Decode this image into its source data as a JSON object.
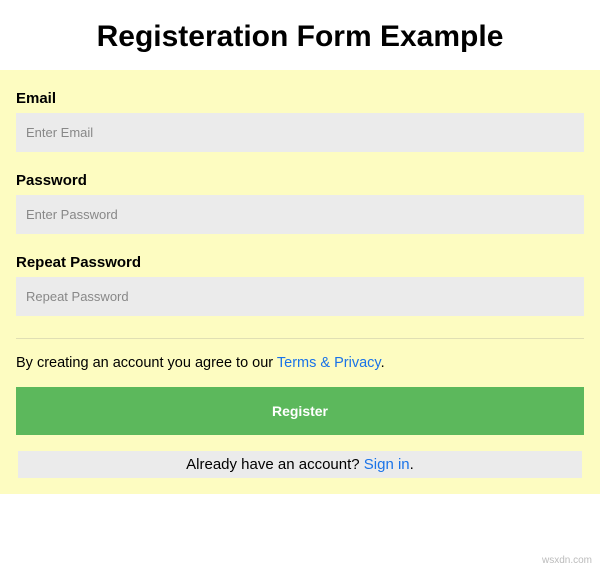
{
  "title": "Registeration Form Example",
  "form": {
    "email": {
      "label": "Email",
      "placeholder": "Enter Email",
      "value": ""
    },
    "password": {
      "label": "Password",
      "placeholder": "Enter Password",
      "value": ""
    },
    "repeat_password": {
      "label": "Repeat Password",
      "placeholder": "Repeat Password",
      "value": ""
    },
    "agree_prefix": "By creating an account you agree to our ",
    "agree_link": "Terms & Privacy",
    "agree_suffix": ".",
    "register_label": "Register",
    "signin_prefix": "Already have an account? ",
    "signin_link": "Sign in",
    "signin_suffix": "."
  },
  "watermark": "wsxdn.com"
}
